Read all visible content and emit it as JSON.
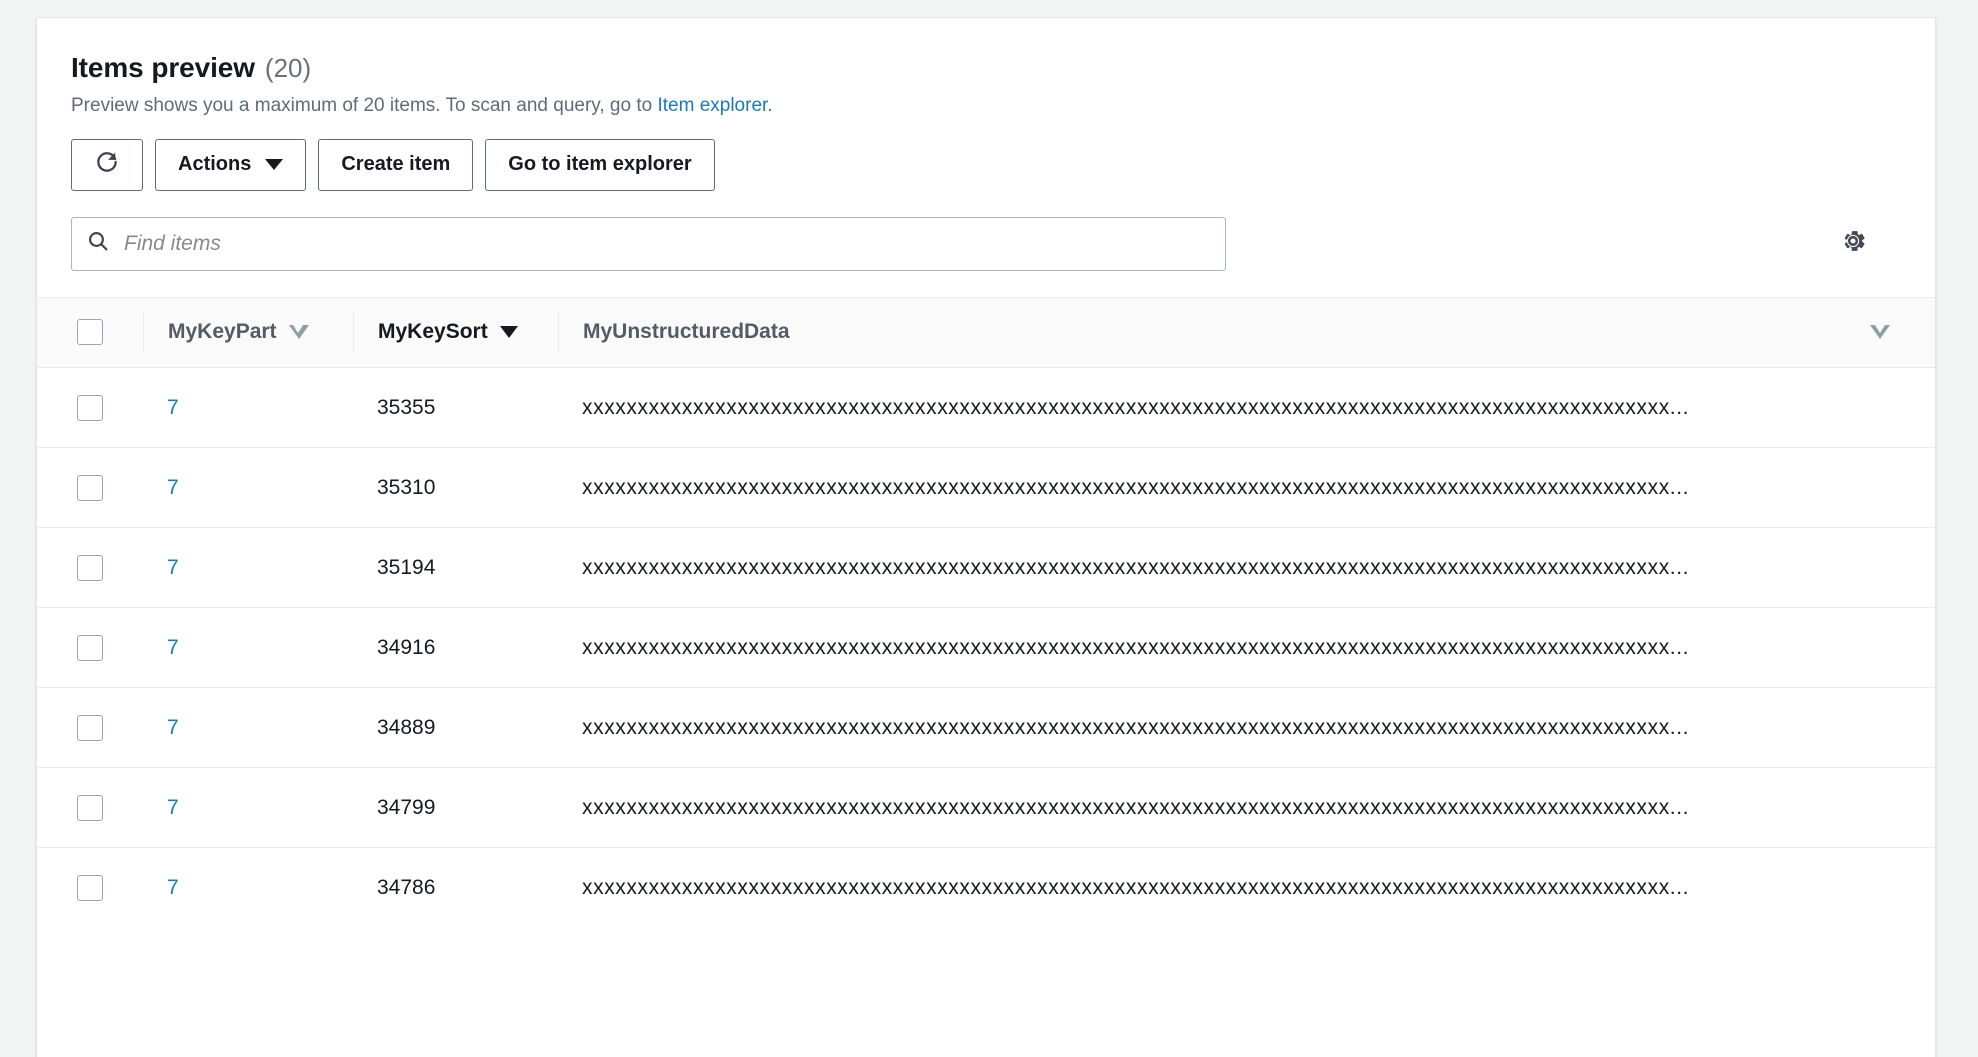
{
  "panel": {
    "title": "Items preview",
    "count": "(20)",
    "description_prefix": "Preview shows you a maximum of 20 items. To scan and query, go to ",
    "description_link": "Item explorer.",
    "link_color": "#1e7ab4"
  },
  "toolbar": {
    "refresh_label": "",
    "refresh_icon": "refresh-icon",
    "actions_label": "Actions",
    "create_item_label": "Create item",
    "go_to_item_explorer_label": "Go to item explorer",
    "settings_icon": "gear-icon"
  },
  "search": {
    "placeholder": "Find items",
    "value": "",
    "icon": "search-icon"
  },
  "table": {
    "select_all_checkbox": false,
    "columns": [
      {
        "label": "MyKeyPart",
        "sort": "inactive",
        "sort_icon": "triangle-down-hollow-icon"
      },
      {
        "label": "MyKeySort",
        "sort": "descending",
        "sort_icon": "triangle-down-solid-icon"
      },
      {
        "label": "MyUnstructuredData",
        "sort": "none",
        "sort_icon": ""
      }
    ],
    "end_column_icon": "triangle-down-hollow-icon",
    "rows": [
      {
        "key_part": "7",
        "key_sort": "35355",
        "data": "xxxxxxxxxxxxxxxxxxxxxxxxxxxxxxxxxxxxxxxxxxxxxxxxxxxxxxxxxxxxxxxxxxxxxxxxxxxxxxxxxxxxxxxxxxxxxxxxxx..."
      },
      {
        "key_part": "7",
        "key_sort": "35310",
        "data": "xxxxxxxxxxxxxxxxxxxxxxxxxxxxxxxxxxxxxxxxxxxxxxxxxxxxxxxxxxxxxxxxxxxxxxxxxxxxxxxxxxxxxxxxxxxxxxxxxx..."
      },
      {
        "key_part": "7",
        "key_sort": "35194",
        "data": "xxxxxxxxxxxxxxxxxxxxxxxxxxxxxxxxxxxxxxxxxxxxxxxxxxxxxxxxxxxxxxxxxxxxxxxxxxxxxxxxxxxxxxxxxxxxxxxxxx..."
      },
      {
        "key_part": "7",
        "key_sort": "34916",
        "data": "xxxxxxxxxxxxxxxxxxxxxxxxxxxxxxxxxxxxxxxxxxxxxxxxxxxxxxxxxxxxxxxxxxxxxxxxxxxxxxxxxxxxxxxxxxxxxxxxxx..."
      },
      {
        "key_part": "7",
        "key_sort": "34889",
        "data": "xxxxxxxxxxxxxxxxxxxxxxxxxxxxxxxxxxxxxxxxxxxxxxxxxxxxxxxxxxxxxxxxxxxxxxxxxxxxxxxxxxxxxxxxxxxxxxxxxx..."
      },
      {
        "key_part": "7",
        "key_sort": "34799",
        "data": "xxxxxxxxxxxxxxxxxxxxxxxxxxxxxxxxxxxxxxxxxxxxxxxxxxxxxxxxxxxxxxxxxxxxxxxxxxxxxxxxxxxxxxxxxxxxxxxxxx..."
      },
      {
        "key_part": "7",
        "key_sort": "34786",
        "data": "xxxxxxxxxxxxxxxxxxxxxxxxxxxxxxxxxxxxxxxxxxxxxxxxxxxxxxxxxxxxxxxxxxxxxxxxxxxxxxxxxxxxxxxxxxxxxxxxxx..."
      }
    ]
  }
}
